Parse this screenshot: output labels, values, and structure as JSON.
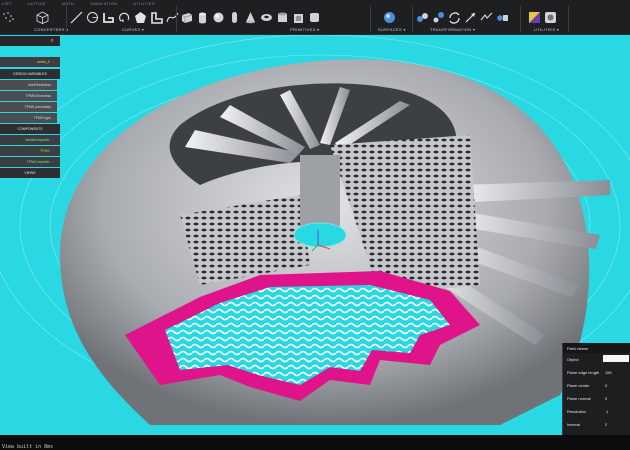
{
  "menu": [
    "LIST",
    "LATTICE",
    "MATH",
    "SIMULATION",
    "UTILITIES"
  ],
  "toolbar": {
    "groups": [
      {
        "label": "CONVERTERS ▾"
      },
      {
        "label": "CURVES ▾"
      },
      {
        "label": "PRIMITIVES ▾"
      },
      {
        "label": "SURFACES ▾"
      },
      {
        "label": "TRANSFORMATION ▾"
      },
      {
        "label": "UTILITIES ▾"
      }
    ]
  },
  "left_panel": {
    "item_mesh": "mesh_0",
    "design_variables_header": "DESIGN VARIABLES",
    "design_variables": [
      "shell thickness",
      "TPMS thickness",
      "TPMS periodicity",
      "TPMS type"
    ],
    "components_header": "COMPONENTS",
    "components": [
      "shelled impeller",
      "TPMS",
      "TPMS impeller"
    ],
    "views_header": "VIEWS"
  },
  "field_viewer": {
    "title": "Field viewer",
    "rows": [
      {
        "key": "Object",
        "value": ""
      },
      {
        "key": "Plane edge length",
        "value": "150"
      },
      {
        "key": "Plane center",
        "value": "0"
      },
      {
        "key": "Plane normal",
        "value": "0"
      },
      {
        "key": "Resolution",
        "value": ".1"
      },
      {
        "key": "Interval",
        "value": "2"
      }
    ]
  },
  "status": "View built in 8ms",
  "colors": {
    "viewport": "#29d8e2",
    "slice": "#e0148a",
    "component_green": "#7ee36b",
    "item_yellow": "#e6e04a"
  }
}
